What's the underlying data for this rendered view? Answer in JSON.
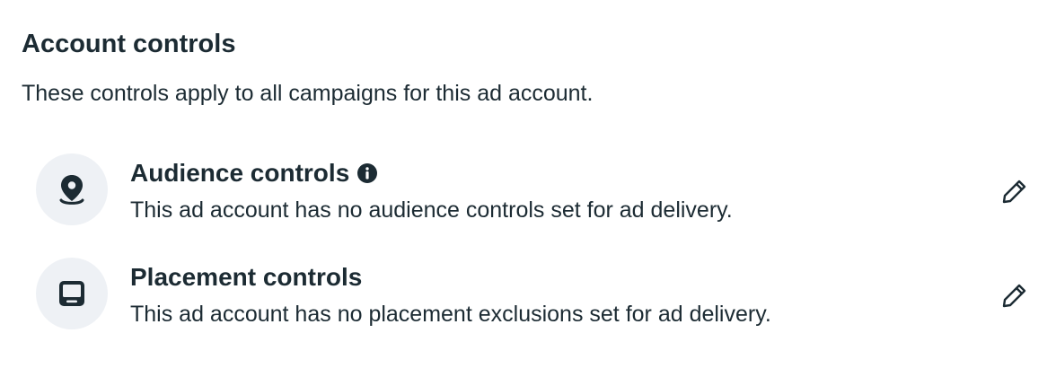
{
  "header": {
    "title": "Account controls",
    "subtitle": "These controls apply to all campaigns for this ad account."
  },
  "controls": [
    {
      "title": "Audience controls",
      "description": "This ad account has no audience controls set for ad delivery.",
      "icon": "location-pin-icon",
      "has_info_icon": true,
      "action_icon": "pencil-edit-icon"
    },
    {
      "title": "Placement controls",
      "description": "This ad account has no placement exclusions set for ad delivery.",
      "icon": "device-screen-icon",
      "has_info_icon": false,
      "action_icon": "pencil-edit-icon"
    }
  ],
  "colors": {
    "text": "#1c2b33",
    "icon_bg": "#eef1f5"
  }
}
